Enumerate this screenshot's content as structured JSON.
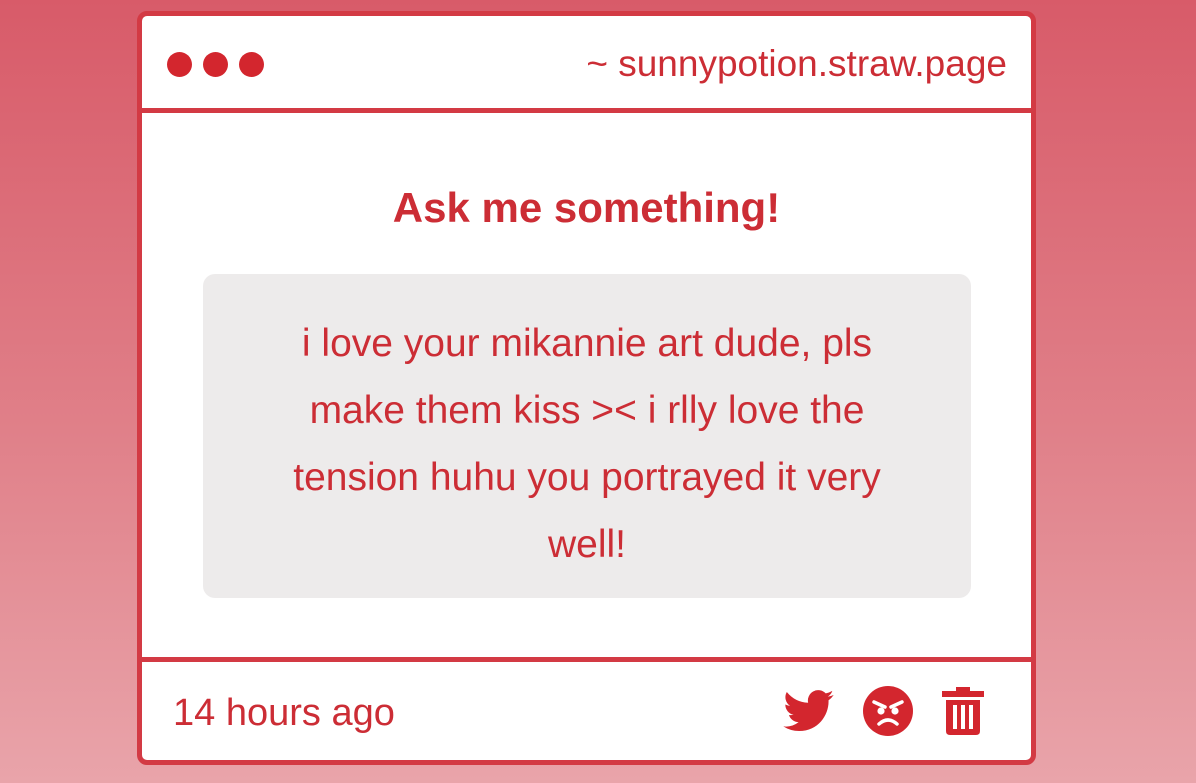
{
  "window": {
    "url": "~ sunnypotion.straw.page"
  },
  "content": {
    "heading": "Ask me something!",
    "message": "i love your mikannie art dude, pls make them kiss >< i rlly love the tension huhu you portrayed it very well!"
  },
  "footer": {
    "timestamp": "14 hours ago",
    "icons": [
      "twitter-icon",
      "angry-face-icon",
      "trash-icon"
    ]
  },
  "colors": {
    "accent": "#d33a44",
    "text": "#cc2d35",
    "bubble": "#edebeb",
    "background_top": "#d85b69",
    "background_bottom": "#e9a4aa"
  }
}
